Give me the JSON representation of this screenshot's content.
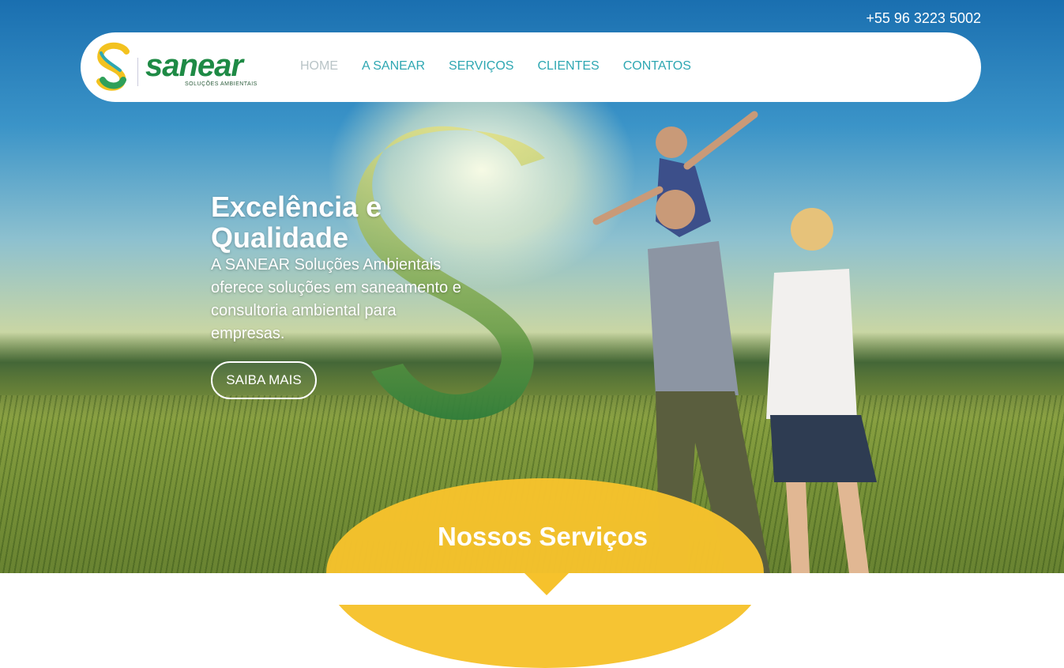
{
  "header": {
    "phone": "+55 96 3223 5002",
    "logo": {
      "word": "sanear",
      "tagline": "SOLUÇÕES AMBIENTAIS"
    },
    "nav": [
      {
        "label": "HOME",
        "active": true
      },
      {
        "label": "A SANEAR",
        "active": false
      },
      {
        "label": "SERVIÇOS",
        "active": false
      },
      {
        "label": "CLIENTES",
        "active": false
      },
      {
        "label": "CONTATOS",
        "active": false
      }
    ]
  },
  "hero": {
    "headline": "Excelência e Qualidade",
    "description": "A SANEAR Soluções Ambientais oferece soluções em saneamento e consultoria ambiental para empresas.",
    "cta_label": "SAIBA MAIS"
  },
  "services": {
    "title": "Nossos Serviços"
  },
  "colors": {
    "nav_text": "#2ea7b2",
    "nav_active": "#b9c4c7",
    "brand_green": "#1e8a45",
    "services_yellow": "#f6c22c"
  }
}
